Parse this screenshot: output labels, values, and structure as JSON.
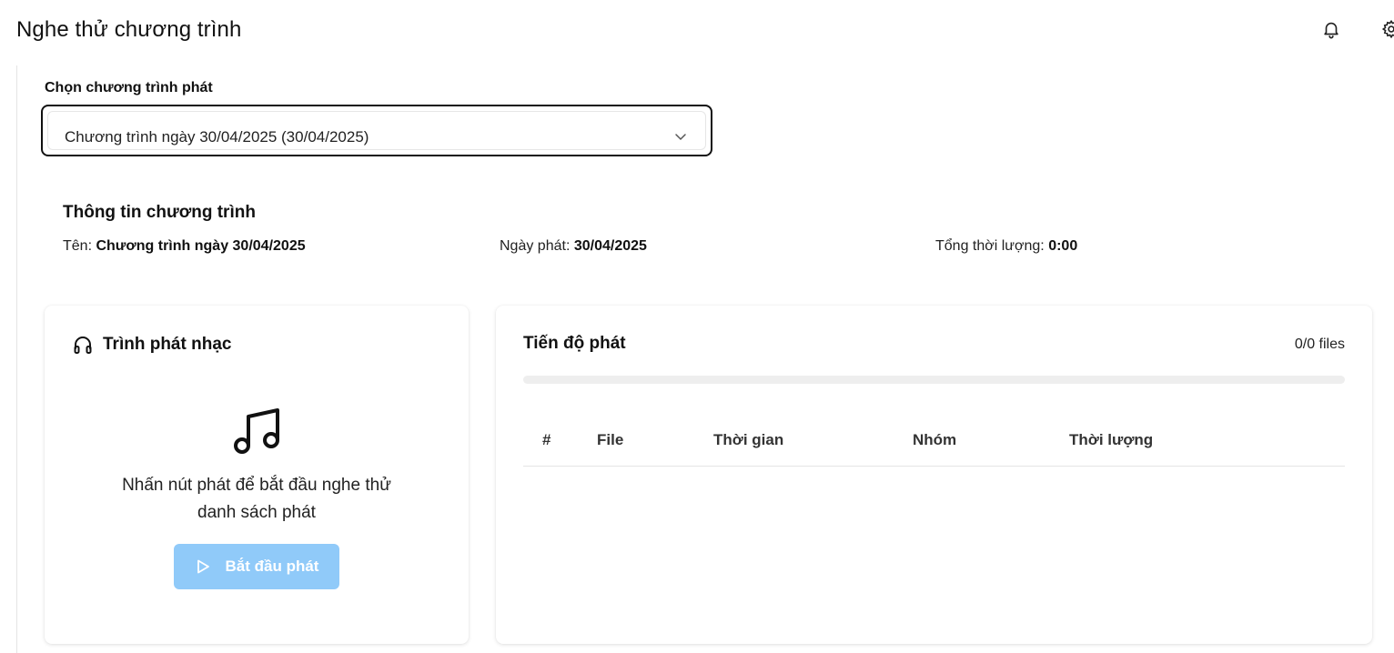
{
  "header": {
    "title": "Nghe thử chương trình",
    "icons": [
      "bell-icon",
      "gear-icon"
    ]
  },
  "program_select": {
    "label": "Chọn chương trình phát",
    "value": "Chương trình ngày 30/04/2025 (30/04/2025)"
  },
  "program_info": {
    "title": "Thông tin chương trình",
    "name_label": "Tên:",
    "name_value": "Chương trình ngày 30/04/2025",
    "date_label": "Ngày phát:",
    "date_value": "30/04/2025",
    "duration_label": "Tổng thời lượng:",
    "duration_value": "0:00"
  },
  "player": {
    "title": "Trình phát nhạc",
    "message_line1": "Nhấn nút phát để bắt đầu nghe thử",
    "message_line2": "danh sách phát",
    "start_label": "Bắt đầu phát",
    "button_color": "#90caf9"
  },
  "progress": {
    "title": "Tiến độ phát",
    "count": "0/0 files",
    "fraction": 0,
    "columns": [
      "#",
      "File",
      "Thời gian",
      "Nhóm",
      "Thời lượng"
    ],
    "rows": []
  }
}
